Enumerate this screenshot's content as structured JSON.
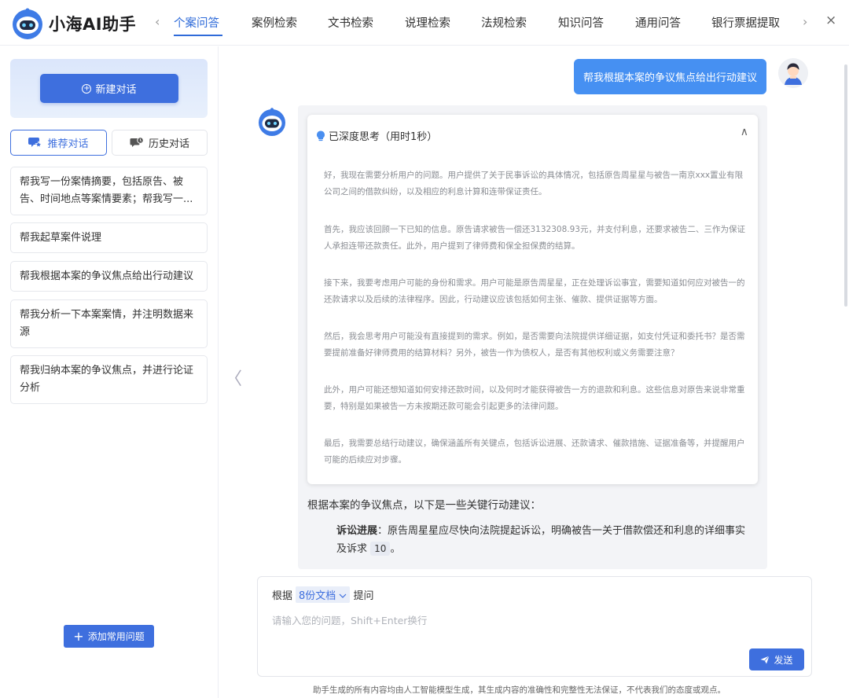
{
  "app": {
    "title": "小海AI助手",
    "logo_icon": "robot-icon"
  },
  "tabs": [
    {
      "label": "个案问答",
      "active": true
    },
    {
      "label": "案例检索"
    },
    {
      "label": "文书检索"
    },
    {
      "label": "说理检索"
    },
    {
      "label": "法规检索"
    },
    {
      "label": "知识问答"
    },
    {
      "label": "通用问答"
    },
    {
      "label": "银行票据提取"
    }
  ],
  "nav": {
    "prev": "‹",
    "next": "›",
    "close": "×"
  },
  "sidebar": {
    "new_chat": "新建对话",
    "recommended_tab": "推荐对话",
    "history_tab": "历史对话",
    "suggestions": [
      "帮我写一份案情摘要，包括原告、被告、时间地点等案情要素；帮我写一...",
      "帮我起草案件说理",
      "帮我根据本案的争议焦点给出行动建议",
      "帮我分析一下本案案情，并注明数据来源",
      "帮我归纳本案的争议焦点，并进行论证分析"
    ],
    "add_common": "添加常用问题"
  },
  "chat": {
    "user_message": "帮我根据本案的争议焦点给出行动建议",
    "thinking_title": "已深度思考（用时1秒）",
    "thinking_paragraphs": [
      "好，我现在需要分析用户的问题。用户提供了关于民事诉讼的具体情况，包括原告周星星与被告一南京xxx置业有限公司之间的借款纠纷，以及相应的利息计算和连带保证责任。",
      "首先，我应该回顾一下已知的信息。原告请求被告一偿还3132308.93元，并支付利息，还要求被告二、三作为保证人承担连带还款责任。此外，用户提到了律师费和保全担保费的结算。",
      "接下来，我要考虑用户可能的身份和需求。用户可能是原告周星星，正在处理诉讼事宜，需要知道如何应对被告一的还款请求以及后续的法律程序。因此，行动建议应该包括如何主张、催款、提供证据等方面。",
      "然后，我会思考用户可能没有直接提到的需求。例如，是否需要向法院提供详细证据，如支付凭证和委托书？是否需要提前准备好律师费用的结算材料？另外，被告一作为债权人，是否有其他权利或义务需要注意？",
      "此外，用户可能还想知道如何安排还款时间，以及何时才能获得被告一方的退款和利息。这些信息对原告来说非常重要，特别是如果被告一方未按期还款可能会引起更多的法律问题。",
      "最后，我需要总结行动建议，确保涵盖所有关键点，包括诉讼进展、还款请求、催款措施、证据准备等，并提醒用户可能的后续应对步骤。"
    ],
    "answer_intro": "根据本案的争议焦点，以下是一些关键行动建议：",
    "answer_item_title": "诉讼进展",
    "answer_item_text": "：原告周星星应尽快向法院提起诉讼，明确被告一关于借款偿还和利息的详细事实及诉求",
    "answer_item_ref": "10",
    "answer_item_end": "。"
  },
  "input": {
    "basis_prefix": "根据",
    "docs_label": "8份文档",
    "basis_suffix": "提问",
    "placeholder": "请输入您的问题，Shift+Enter换行",
    "send": "发送"
  },
  "disclaimer": "助手生成的所有内容均由人工智能模型生成，其生成内容的准确性和完整性无法保证，不代表我们的态度或观点。",
  "colors": {
    "primary": "#3e6fde",
    "user_bubble": "#4690f2",
    "active_tab": "#2f6bd9"
  }
}
